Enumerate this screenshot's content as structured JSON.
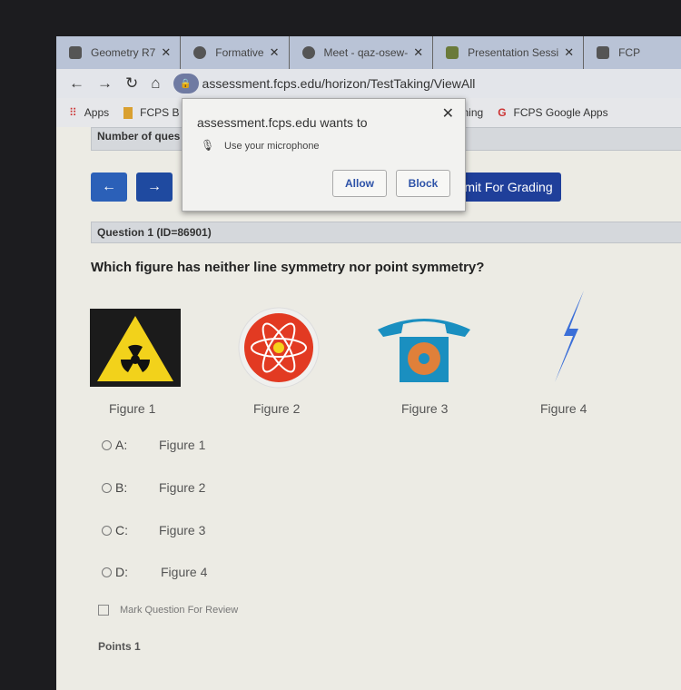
{
  "tabs": [
    {
      "title": "Geometry R7",
      "icon": "classroom-icon"
    },
    {
      "title": "Formative",
      "icon": "formative-icon"
    },
    {
      "title": "Meet - qaz-osew-",
      "icon": "meet-icon"
    },
    {
      "title": "Presentation Sessi",
      "icon": "presentation-icon"
    },
    {
      "title": "FCP",
      "icon": "fcps-icon"
    }
  ],
  "address": {
    "url": "assessment.fcps.edu/horizon/TestTaking/ViewAll"
  },
  "bookmarks": {
    "apps": "Apps",
    "fcps": "FCPS B",
    "learning": "rning",
    "google_apps": "FCPS Google Apps"
  },
  "popup": {
    "title": "assessment.fcps.edu wants to",
    "permission": "Use your microphone",
    "allow": "Allow",
    "block": "Block"
  },
  "page": {
    "number_of_questions": "Number of ques",
    "submit": "mit For Grading",
    "question_header": "Question 1 (ID=86901)",
    "question": "Which figure has neither line symmetry nor point symmetry?",
    "figures": [
      "Figure 1",
      "Figure 2",
      "Figure 3",
      "Figure 4"
    ],
    "options": [
      {
        "letter": "A:",
        "text": "Figure 1"
      },
      {
        "letter": "B:",
        "text": "Figure 2"
      },
      {
        "letter": "C:",
        "text": "Figure 3"
      },
      {
        "letter": "D:",
        "text": "Figure 4"
      }
    ],
    "mark_review": "Mark Question For Review",
    "points": "Points 1"
  },
  "colors": {
    "primary_button": "#2b60b8",
    "tab_bar": "#b9c3d6"
  }
}
